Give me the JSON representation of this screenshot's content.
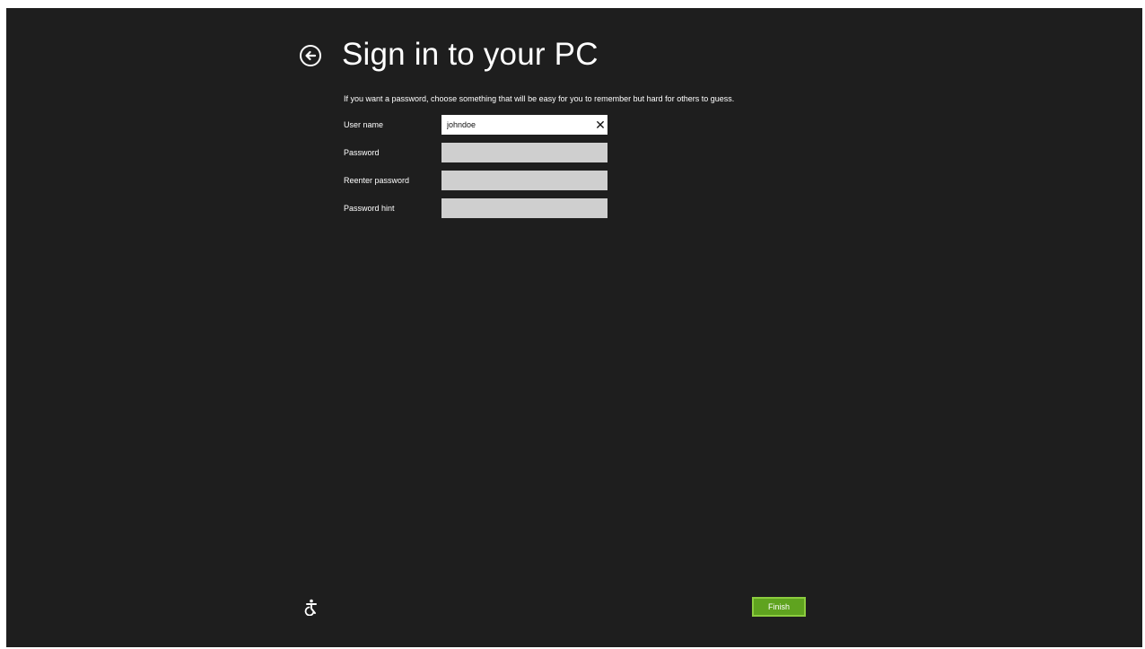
{
  "page": {
    "title": "Sign in to your PC",
    "instructions": "If you want a password, choose something that will be easy for you to remember but hard for others to guess."
  },
  "form": {
    "fields": [
      {
        "label": "User name",
        "value": "johndoe",
        "placeholder": ""
      },
      {
        "label": "Password",
        "value": "",
        "placeholder": ""
      },
      {
        "label": "Reenter password",
        "value": "",
        "placeholder": ""
      },
      {
        "label": "Password hint",
        "value": "",
        "placeholder": ""
      }
    ],
    "clear_symbol": "✕"
  },
  "footer": {
    "finish_label": "Finish"
  },
  "icons": {
    "back": "back-arrow-circle-icon",
    "clear": "close-icon",
    "accessibility": "ease-of-access-icon"
  },
  "colors": {
    "background": "#1e1e1e",
    "accent_green": "#5fa31f",
    "input_inactive": "#cfcfcf",
    "input_active": "#ffffff"
  }
}
